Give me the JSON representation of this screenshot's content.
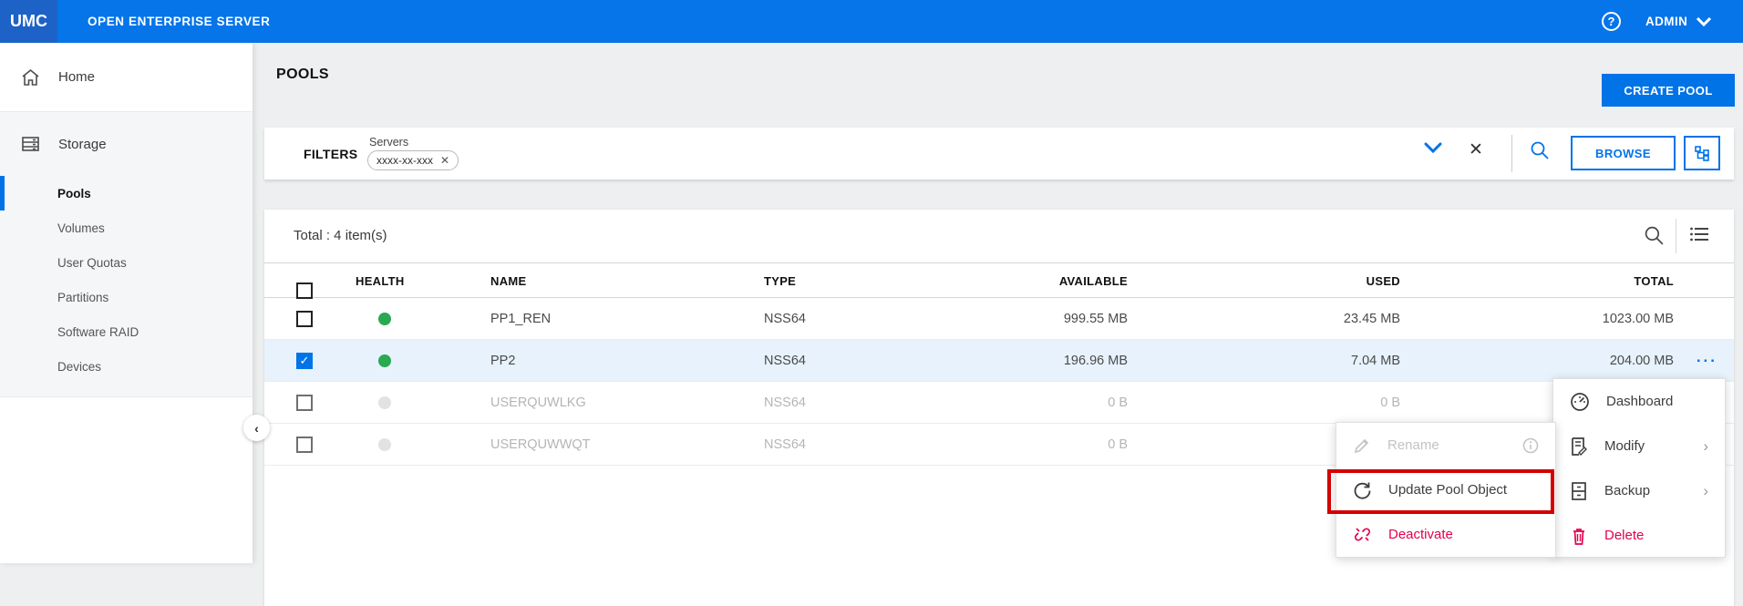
{
  "topbar": {
    "logo": "UMC",
    "product": "OPEN ENTERPRISE SERVER",
    "user": "ADMIN"
  },
  "sidebar": {
    "home": "Home",
    "group": "Storage",
    "items": [
      {
        "label": "Pools",
        "active": true
      },
      {
        "label": "Volumes",
        "active": false
      },
      {
        "label": "User Quotas",
        "active": false
      },
      {
        "label": "Partitions",
        "active": false
      },
      {
        "label": "Software RAID",
        "active": false
      },
      {
        "label": "Devices",
        "active": false
      }
    ]
  },
  "page": {
    "title": "POOLS",
    "create_button": "CREATE POOL"
  },
  "filters": {
    "label": "FILTERS",
    "field_label": "Servers",
    "chip": "xxxx-xx-xxx",
    "browse_button": "BROWSE"
  },
  "table": {
    "total": "Total : 4 item(s)",
    "columns": {
      "health": "HEALTH",
      "name": "NAME",
      "type": "TYPE",
      "available": "AVAILABLE",
      "used": "USED",
      "total": "TOTAL"
    },
    "rows": [
      {
        "name": "PP1_REN",
        "type": "NSS64",
        "available": "999.55 MB",
        "used": "23.45 MB",
        "total": "1023.00 MB",
        "health": "green",
        "checked": false,
        "selected": false,
        "disabled": false
      },
      {
        "name": "PP2",
        "type": "NSS64",
        "available": "196.96 MB",
        "used": "7.04 MB",
        "total": "204.00 MB",
        "health": "green",
        "checked": true,
        "selected": true,
        "disabled": false
      },
      {
        "name": "USERQUWLKG",
        "type": "NSS64",
        "available": "0 B",
        "used": "0 B",
        "total": "",
        "health": "gray",
        "checked": false,
        "selected": false,
        "disabled": true
      },
      {
        "name": "USERQUWWQT",
        "type": "NSS64",
        "available": "0 B",
        "used": "",
        "total": "",
        "health": "gray",
        "checked": false,
        "selected": false,
        "disabled": true
      }
    ],
    "row_overflow": "..."
  },
  "row_menu": {
    "dashboard": "Dashboard",
    "modify": "Modify",
    "backup": "Backup",
    "delete": "Delete"
  },
  "action_menu": {
    "rename": "Rename",
    "update": "Update Pool Object",
    "deactivate": "Deactivate"
  },
  "colors": {
    "accent": "#0073e7",
    "topbar": "#0575e9",
    "logo_box": "#1d62c6",
    "pink": "#e5004c",
    "annotation_red": "#d40000",
    "health_green": "#2aa952",
    "selected_row": "#e7f2fc"
  }
}
